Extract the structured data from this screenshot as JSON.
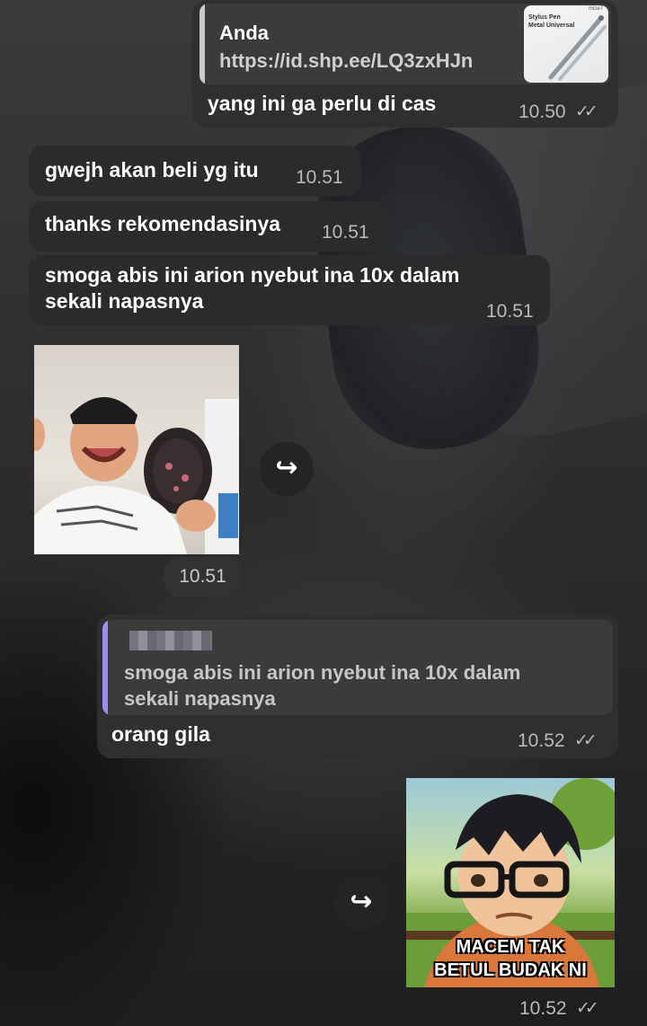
{
  "colors": {
    "bubble_out": "#2f2f2f",
    "bubble_in": "#2b2b2b",
    "reply_accent": "#9b8cf0",
    "text": "#ffffff",
    "meta": "#b9b9b9"
  },
  "messages": {
    "m1": {
      "reply_author": "Anda",
      "reply_link": "https://id.shp.ee/LQ3zxHJn",
      "thumb_brand": "mize7",
      "thumb_title_1": "Stylus Pen",
      "thumb_title_2": "Metal Universal",
      "text": "yang ini ga perlu di cas",
      "time": "10.50",
      "ticks": "✓✓"
    },
    "m2": {
      "text": "gwejh akan beli yg itu",
      "time": "10.51"
    },
    "m3": {
      "text": "thanks rekomendasinya",
      "time": "10.51"
    },
    "m4": {
      "line1": "smoga abis ini arion nyebut ina 10x dalam",
      "line2": "sekali napasnya",
      "time": "10.51"
    },
    "m5": {
      "time": "10.51",
      "forward_icon": "forward-icon"
    },
    "m6": {
      "reply_line1": "smoga abis ini arion nyebut ina 10x dalam",
      "reply_line2": "sekali napasnya",
      "text": "orang gila",
      "time": "10.52",
      "ticks": "✓✓"
    },
    "m7": {
      "caption_1": "MACEM TAK",
      "caption_2": "BETUL BUDAK NI",
      "time": "10.52",
      "ticks": "✓✓",
      "forward_icon": "forward-icon"
    }
  }
}
